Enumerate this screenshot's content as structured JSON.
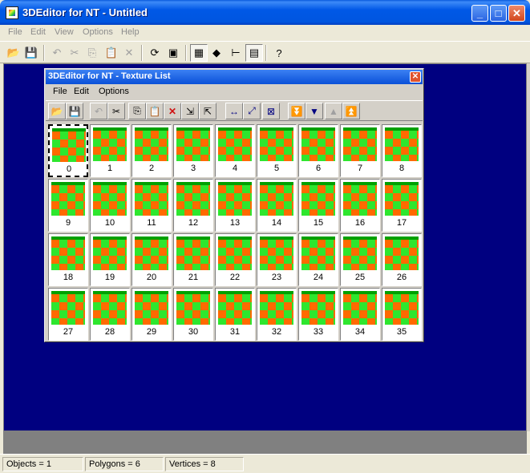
{
  "window": {
    "title": "3DEditor for NT - Untitled"
  },
  "window_buttons": {
    "minimize": "_",
    "maximize": "□",
    "close": "✕"
  },
  "menu": [
    "File",
    "Edit",
    "View",
    "Options",
    "Help"
  ],
  "toolbar_icons": [
    "open-folder-icon",
    "save-icon",
    "undo-icon",
    "cut-icon",
    "copy-icon",
    "paste-icon",
    "delete-icon",
    "rotate-icon",
    "render-icon",
    "grid-icon",
    "cube-icon",
    "tree-icon",
    "palette-icon",
    "help-icon"
  ],
  "toolbar_glyphs": {
    "open": "📂",
    "save": "💾",
    "undo": "↶",
    "cut": "✂",
    "copy": "⎘",
    "paste": "📋",
    "delete": "✕",
    "rotate": "⟳",
    "render": "▣",
    "grid": "▦",
    "cube": "◆",
    "tree": "⊢",
    "palette": "▤",
    "help": "?"
  },
  "child": {
    "title": "3DEditor for NT - Texture List",
    "close": "✕",
    "menu": [
      "File",
      "Edit",
      "Options"
    ],
    "tools": {
      "open": "📂",
      "save": "💾",
      "undo": "↶",
      "cut": "✂",
      "copy": "⎘",
      "paste": "📋",
      "delete": "✕",
      "import": "⇲",
      "export": "⇱",
      "fit_width": "↔",
      "resize": "⤢",
      "fit": "⊠",
      "move_bottom": "⏬",
      "move_down": "▼",
      "move_up": "▲",
      "move_top": "⏫"
    }
  },
  "textures": [
    "0",
    "1",
    "2",
    "3",
    "4",
    "5",
    "6",
    "7",
    "8",
    "9",
    "10",
    "11",
    "12",
    "13",
    "14",
    "15",
    "16",
    "17",
    "18",
    "19",
    "20",
    "21",
    "22",
    "23",
    "24",
    "25",
    "26",
    "27",
    "28",
    "29",
    "30",
    "31",
    "32",
    "33",
    "34",
    "35"
  ],
  "selected_texture": "0",
  "status": {
    "objects": "Objects = 1",
    "polygons": "Polygons = 6",
    "vertices": "Vertices = 8"
  },
  "colors": {
    "workspace": "#000080",
    "checker_a": "#FF6A00",
    "checker_b": "#2EE62E"
  }
}
